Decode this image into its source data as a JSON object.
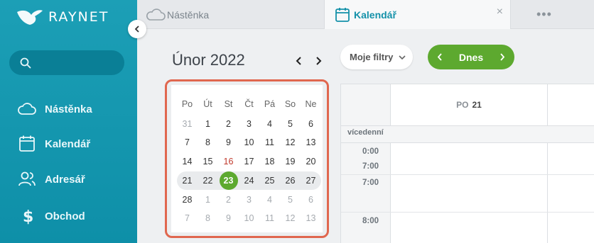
{
  "app": {
    "brand": "RAYNET"
  },
  "sidebar": {
    "search": {
      "placeholder": ""
    },
    "items": [
      {
        "label": "Nástěnka",
        "icon": "cloud-icon"
      },
      {
        "label": "Kalendář",
        "icon": "calendar-icon"
      },
      {
        "label": "Adresář",
        "icon": "contacts-icon"
      },
      {
        "label": "Obchod",
        "icon": "dollar-icon"
      }
    ]
  },
  "tabs": [
    {
      "label": "Nástěnka",
      "icon": "cloud-icon"
    },
    {
      "label": "Kalendář",
      "icon": "calendar-icon",
      "active": true,
      "close": "×"
    },
    {
      "label": "•••"
    }
  ],
  "header": {
    "month_title": "Únor 2022",
    "filters_label": "Moje filtry",
    "today_label": "Dnes"
  },
  "mini_calendar": {
    "weekdays": [
      "Po",
      "Út",
      "St",
      "Čt",
      "Pá",
      "So",
      "Ne"
    ],
    "weeks": [
      [
        "31",
        "1",
        "2",
        "3",
        "4",
        "5",
        "6"
      ],
      [
        "7",
        "8",
        "9",
        "10",
        "11",
        "12",
        "13"
      ],
      [
        "14",
        "15",
        "16",
        "17",
        "18",
        "19",
        "20"
      ],
      [
        "21",
        "22",
        "23",
        "24",
        "25",
        "26",
        "27"
      ],
      [
        "28",
        "1",
        "2",
        "3",
        "4",
        "5",
        "6"
      ],
      [
        "7",
        "8",
        "9",
        "10",
        "11",
        "12",
        "13"
      ]
    ],
    "today": "23",
    "holiday": "16"
  },
  "week_view": {
    "day_name": "PO",
    "day_number": "21",
    "allday_label": "vícedenní",
    "time_labels": [
      "0:00",
      "7:00",
      "7:00",
      "8:00"
    ]
  },
  "colors": {
    "sidebar": "#1598b0",
    "accent_green": "#5da92f",
    "highlight_border": "#e0674f",
    "tab_active_text": "#1491a9"
  }
}
